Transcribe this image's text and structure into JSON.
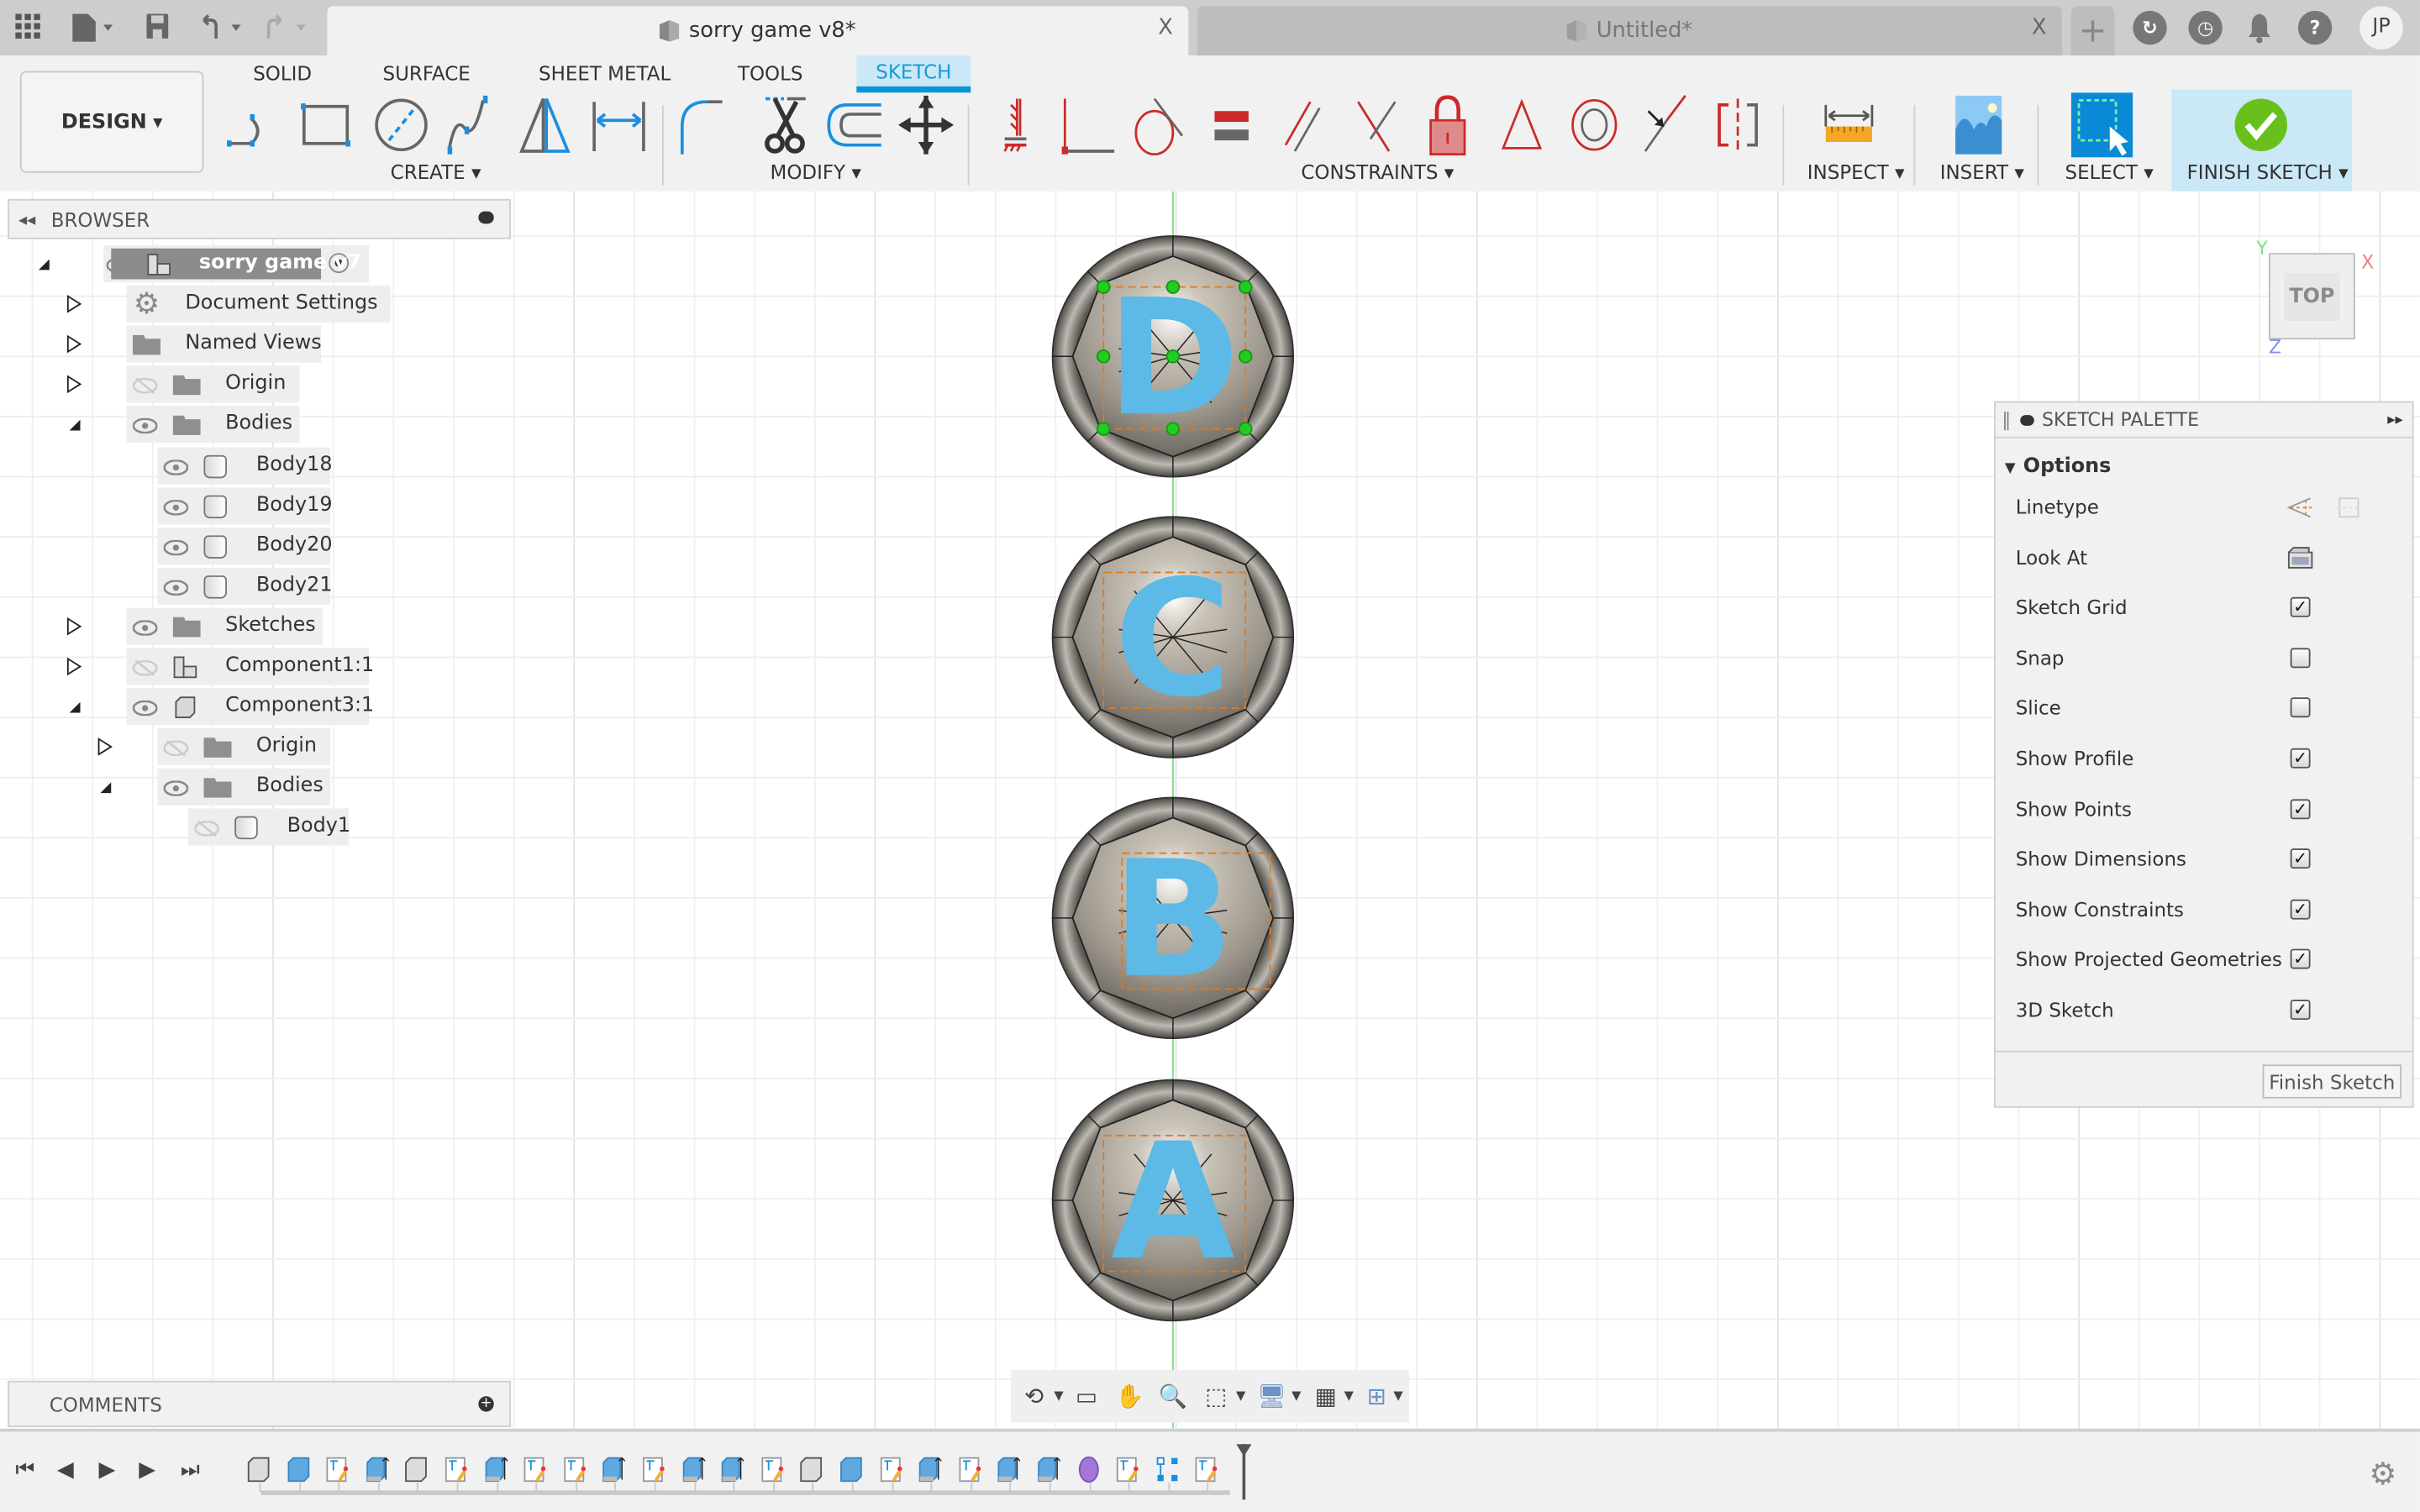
{
  "titlebar": {
    "active_tab": "sorry game v8*",
    "inactive_tab": "Untitled*",
    "close_glyph": "X",
    "new_tab_glyph": "+",
    "user_initials": "JP",
    "icons": [
      "app-grid-icon",
      "file-icon",
      "save-icon",
      "undo-icon",
      "redo-icon",
      "extensions-icon",
      "job-status-icon",
      "notifications-icon",
      "help-icon"
    ]
  },
  "toolbar": {
    "workspace": "DESIGN",
    "tabs": [
      "SOLID",
      "SURFACE",
      "SHEET METAL",
      "TOOLS",
      "SKETCH"
    ],
    "active_tab": "SKETCH",
    "groups": {
      "create": "CREATE",
      "modify": "MODIFY",
      "constraints": "CONSTRAINTS",
      "inspect": "INSPECT",
      "insert": "INSERT",
      "select": "SELECT",
      "finish": "FINISH SKETCH"
    },
    "create_tools": [
      "line",
      "rectangle",
      "circle",
      "spline",
      "mirror",
      "sketch-dimension"
    ],
    "modify_tools": [
      "fillet",
      "trim",
      "offset",
      "move-copy"
    ],
    "constraint_tools": [
      "fix",
      "coincident",
      "tangent",
      "equal",
      "parallel",
      "perpendicular",
      "fix-lock",
      "horizontal-vertical",
      "concentric",
      "midpoint",
      "symmetry"
    ]
  },
  "browser": {
    "title": "BROWSER",
    "items": [
      {
        "label": "sorry game v7",
        "level": 0,
        "expanded": true,
        "icon": "component",
        "visible": true,
        "active": true
      },
      {
        "label": "Document Settings",
        "level": 1,
        "expanded": false,
        "icon": "gear"
      },
      {
        "label": "Named Views",
        "level": 1,
        "expanded": false,
        "icon": "folder"
      },
      {
        "label": "Origin",
        "level": 1,
        "expanded": false,
        "icon": "folder",
        "visible": false
      },
      {
        "label": "Bodies",
        "level": 1,
        "expanded": true,
        "icon": "folder",
        "visible": true
      },
      {
        "label": "Body18",
        "level": 2,
        "icon": "body",
        "visible": true
      },
      {
        "label": "Body19",
        "level": 2,
        "icon": "body",
        "visible": true
      },
      {
        "label": "Body20",
        "level": 2,
        "icon": "body",
        "visible": true
      },
      {
        "label": "Body21",
        "level": 2,
        "icon": "body",
        "visible": true
      },
      {
        "label": "Sketches",
        "level": 1,
        "expanded": false,
        "icon": "folder",
        "visible": true
      },
      {
        "label": "Component1:1",
        "level": 1,
        "expanded": false,
        "icon": "component",
        "visible": false
      },
      {
        "label": "Component3:1",
        "level": 1,
        "expanded": true,
        "icon": "component-box",
        "visible": true
      },
      {
        "label": "Origin",
        "level": 2,
        "expanded": false,
        "icon": "folder",
        "visible": false
      },
      {
        "label": "Bodies",
        "level": 2,
        "expanded": true,
        "icon": "folder",
        "visible": true
      },
      {
        "label": "Body1",
        "level": 3,
        "icon": "body",
        "visible": false
      }
    ]
  },
  "comments": {
    "title": "COMMENTS"
  },
  "viewcube": {
    "face": "TOP",
    "axes": {
      "x": "X",
      "y": "Y",
      "z": "Z"
    }
  },
  "canvas": {
    "tokens": [
      "D",
      "C",
      "B",
      "A"
    ],
    "letter_color": "#5db9e6"
  },
  "sketch_palette": {
    "title": "SKETCH PALETTE",
    "section": "Options",
    "rows": [
      {
        "label": "Linetype",
        "type": "icons"
      },
      {
        "label": "Look At",
        "type": "icon"
      },
      {
        "label": "Sketch Grid",
        "type": "checkbox",
        "checked": true
      },
      {
        "label": "Snap",
        "type": "checkbox",
        "checked": false
      },
      {
        "label": "Slice",
        "type": "checkbox",
        "checked": false
      },
      {
        "label": "Show Profile",
        "type": "checkbox",
        "checked": true
      },
      {
        "label": "Show Points",
        "type": "checkbox",
        "checked": true
      },
      {
        "label": "Show Dimensions",
        "type": "checkbox",
        "checked": true
      },
      {
        "label": "Show Constraints",
        "type": "checkbox",
        "checked": true
      },
      {
        "label": "Show Projected Geometries",
        "type": "checkbox",
        "checked": true
      },
      {
        "label": "3D Sketch",
        "type": "checkbox",
        "checked": true
      }
    ],
    "finish_button": "Finish Sketch"
  },
  "navbar": {
    "tools": [
      "orbit",
      "look-at",
      "pan",
      "zoom",
      "zoom-window",
      "display-settings",
      "grid-snaps",
      "viewports"
    ]
  },
  "timeline": {
    "features": [
      "box",
      "extrude",
      "sketch",
      "extrude-arrow",
      "box",
      "sketch",
      "extrude-arrow",
      "sketch",
      "sketch",
      "extrude-arrow",
      "sketch",
      "extrude-arrow",
      "extrude-arrow",
      "sketch",
      "box",
      "extrude",
      "sketch",
      "extrude-arrow",
      "sketch",
      "extrude-arrow",
      "extrude-arrow",
      "form",
      "sketch",
      "pattern",
      "sketch"
    ]
  },
  "colors": {
    "accent": "#0696d7",
    "active_tab_bg": "#cbe8f6",
    "finish_green": "#6ac01a",
    "constraint_red": "#cc2a2a",
    "grid_line": "#e9e9e9",
    "axis_green": "#8fe08f"
  }
}
